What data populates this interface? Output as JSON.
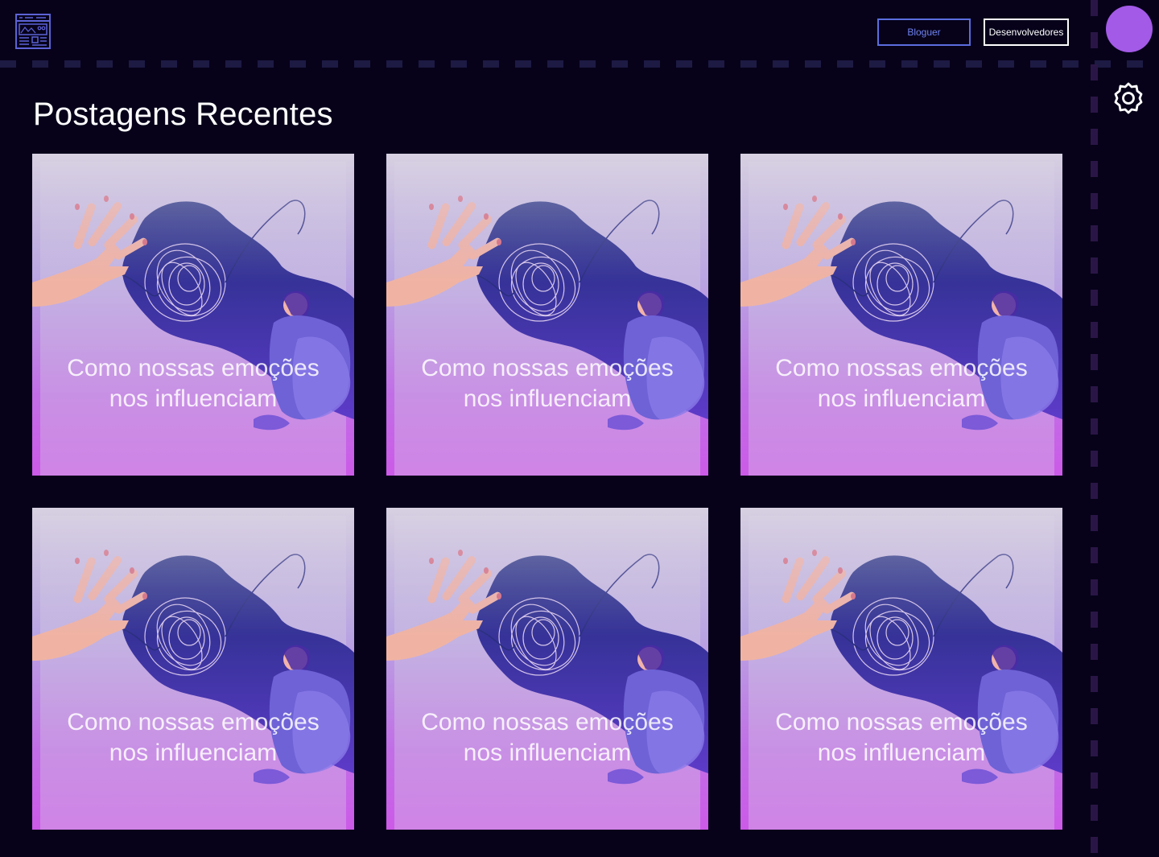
{
  "header": {
    "buttons": {
      "bloguer": "Bloguer",
      "desenvolvedores": "Desenvolvedores"
    },
    "icons": {
      "logo": "website-layout-icon",
      "settings": "gear-icon",
      "avatar": "avatar"
    }
  },
  "main": {
    "title": "Postagens Recentes",
    "posts": [
      {
        "title_line1": "Como nossas emoções",
        "title_line2": "nos influenciam"
      },
      {
        "title_line1": "Como nossas emoções",
        "title_line2": "nos influenciam"
      },
      {
        "title_line1": "Como nossas emoções",
        "title_line2": "nos influenciam"
      },
      {
        "title_line1": "Como nossas emoções",
        "title_line2": "nos influenciam"
      },
      {
        "title_line1": "Como nossas emoções",
        "title_line2": "nos influenciam"
      },
      {
        "title_line1": "Como nossas emoções",
        "title_line2": "nos influenciam"
      }
    ]
  },
  "colors": {
    "background": "#07021a",
    "accent_blue": "#5b6dde",
    "avatar_purple": "#a35ae6",
    "card_gradient_top": "#c9c3da",
    "card_gradient_bottom": "#cc5ae8"
  }
}
